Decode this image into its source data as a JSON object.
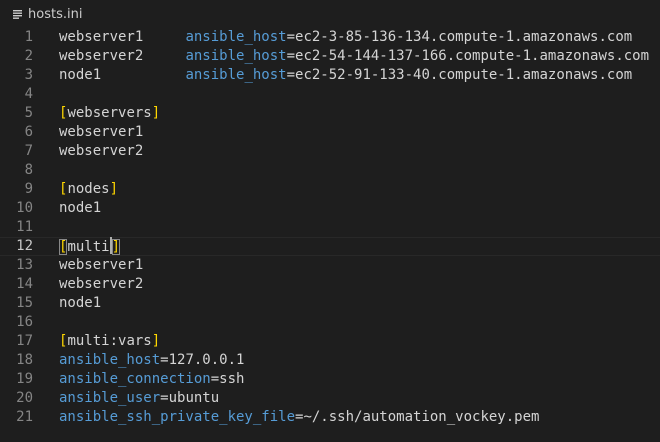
{
  "breadcrumb": {
    "icon": "lines-file-icon",
    "filename": "hosts.ini"
  },
  "editor": {
    "current_line": 12,
    "lines": [
      {
        "n": "1",
        "a": "webserver1     ",
        "b": "ansible_host",
        "c": "=ec2-3-85-136-134.compute-1.amazonaws.com"
      },
      {
        "n": "2",
        "a": "webserver2     ",
        "b": "ansible_host",
        "c": "=ec2-54-144-137-166.compute-1.amazonaws.com"
      },
      {
        "n": "3",
        "a": "node1          ",
        "b": "ansible_host",
        "c": "=ec2-52-91-133-40.compute-1.amazonaws.com"
      },
      {
        "n": "4"
      },
      {
        "n": "5",
        "open": "[",
        "name": "webservers",
        "close": "]"
      },
      {
        "n": "6",
        "a": "webserver1"
      },
      {
        "n": "7",
        "a": "webserver2"
      },
      {
        "n": "8"
      },
      {
        "n": "9",
        "open": "[",
        "name": "nodes",
        "close": "]"
      },
      {
        "n": "10",
        "a": "node1"
      },
      {
        "n": "11"
      },
      {
        "n": "12",
        "open": "[",
        "name": "multi",
        "close": "]"
      },
      {
        "n": "13",
        "a": "webserver1"
      },
      {
        "n": "14",
        "a": "webserver2"
      },
      {
        "n": "15",
        "a": "node1"
      },
      {
        "n": "16"
      },
      {
        "n": "17",
        "open": "[",
        "name": "multi:vars",
        "close": "]"
      },
      {
        "n": "18",
        "b": "ansible_host",
        "c": "=127.0.0.1"
      },
      {
        "n": "19",
        "b": "ansible_connection",
        "c": "=ssh"
      },
      {
        "n": "20",
        "b": "ansible_user",
        "c": "=ubuntu"
      },
      {
        "n": "21",
        "b": "ansible_ssh_private_key_file",
        "c": "=~/.ssh/automation_vockey.pem"
      }
    ]
  },
  "colors": {
    "background": "#1e1e1e",
    "text": "#d4d4d4",
    "key": "#569cd6",
    "bracket": "#ffd700",
    "line_number": "#858585"
  }
}
